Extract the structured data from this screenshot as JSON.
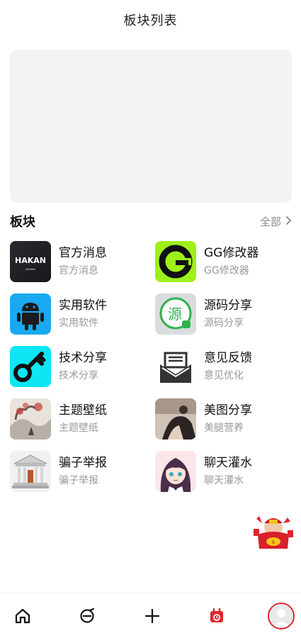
{
  "header": {
    "title": "板块列表"
  },
  "section": {
    "title": "板块",
    "see_all": "全部"
  },
  "boards": [
    {
      "name": "官方消息",
      "desc": "官方消息",
      "icon": "hakan-logo-icon",
      "thumb_text": "HAKAN"
    },
    {
      "name": "GG修改器",
      "desc": "GG修改器",
      "icon": "gg-logo-icon"
    },
    {
      "name": "实用软件",
      "desc": "实用软件",
      "icon": "android-icon"
    },
    {
      "name": "源码分享",
      "desc": "源码分享",
      "icon": "source-code-icon",
      "thumb_text": "源"
    },
    {
      "name": "技术分享",
      "desc": "技术分享",
      "icon": "key-icon"
    },
    {
      "name": "意见反馈",
      "desc": "意见优化",
      "icon": "feedback-mailbox-icon"
    },
    {
      "name": "主题壁纸",
      "desc": "主题壁纸",
      "icon": "wallpaper-painting-icon"
    },
    {
      "name": "美图分享",
      "desc": "美腿营养",
      "icon": "photo-thumbnail-icon"
    },
    {
      "name": "骗子举报",
      "desc": "骗子举报",
      "icon": "courthouse-icon"
    },
    {
      "name": "聊天灌水",
      "desc": "聊天灌水",
      "icon": "anime-girl-icon"
    }
  ],
  "tabbar": {
    "items": [
      "home-icon",
      "discover-icon",
      "add-icon",
      "calendar-icon",
      "avatar"
    ]
  },
  "colors": {
    "accent": "#e0272d",
    "muted": "#999999",
    "banner": "#f2f3f5"
  }
}
